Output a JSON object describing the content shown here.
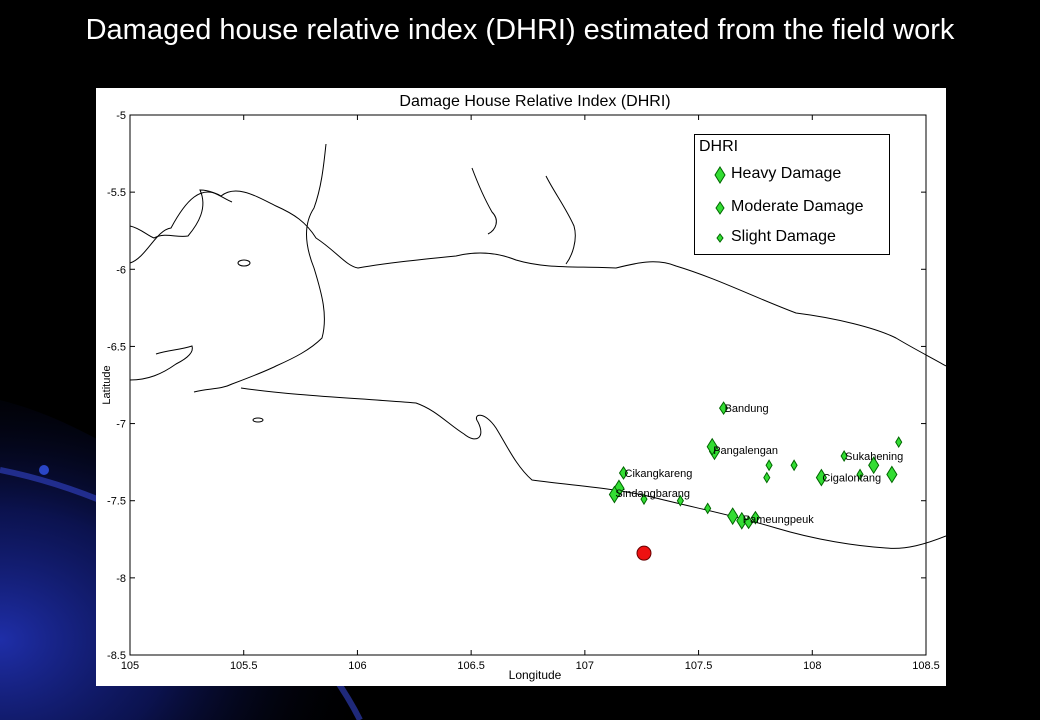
{
  "slide": {
    "title": "Damaged house relative index (DHRI) estimated from the field work"
  },
  "colors": {
    "background": "#000000",
    "swoosh": "#1a2a9a",
    "marker_fill": "#33dd33",
    "marker_stroke": "#006600",
    "epicenter": "#ee1111",
    "coast": "#000000"
  },
  "chart_data": {
    "type": "scatter",
    "title": "Damage House Relative Index (DHRI)",
    "xlabel": "Longitude",
    "ylabel": "Latitude",
    "xlim": [
      105,
      108.5
    ],
    "ylim": [
      -8.5,
      -5
    ],
    "xticks": [
      "105",
      "105.5",
      "106",
      "106.5",
      "107",
      "107.5",
      "108",
      "108.5"
    ],
    "yticks": [
      "-5",
      "-5.5",
      "-6",
      "-6.5",
      "-7",
      "-7.5",
      "-8",
      "-8.5"
    ],
    "grid": false,
    "legend_title": "DHRI",
    "legend_position": "top-right",
    "series": [
      {
        "name": "Heavy Damage",
        "size": "large",
        "points": [
          {
            "x": 107.57,
            "y": -7.18
          },
          {
            "x": 107.56,
            "y": -7.15
          },
          {
            "x": 107.15,
            "y": -7.42
          },
          {
            "x": 107.13,
            "y": -7.46
          },
          {
            "x": 107.65,
            "y": -7.6
          },
          {
            "x": 107.69,
            "y": -7.63
          },
          {
            "x": 108.27,
            "y": -7.27
          },
          {
            "x": 108.04,
            "y": -7.35
          },
          {
            "x": 108.35,
            "y": -7.33
          }
        ]
      },
      {
        "name": "Moderate Damage",
        "size": "medium",
        "points": [
          {
            "x": 107.61,
            "y": -6.9
          },
          {
            "x": 107.17,
            "y": -7.32
          },
          {
            "x": 107.75,
            "y": -7.61
          },
          {
            "x": 107.72,
            "y": -7.64
          }
        ]
      },
      {
        "name": "Slight Damage",
        "size": "small",
        "points": [
          {
            "x": 107.26,
            "y": -7.49
          },
          {
            "x": 107.42,
            "y": -7.5
          },
          {
            "x": 107.54,
            "y": -7.55
          },
          {
            "x": 107.8,
            "y": -7.35
          },
          {
            "x": 107.81,
            "y": -7.27
          },
          {
            "x": 107.92,
            "y": -7.27
          },
          {
            "x": 108.14,
            "y": -7.21
          },
          {
            "x": 108.21,
            "y": -7.33
          },
          {
            "x": 108.38,
            "y": -7.12
          }
        ]
      }
    ],
    "epicenter": {
      "x": 107.26,
      "y": -7.84
    },
    "place_labels": [
      {
        "text": "Bandung",
        "x": 107.61,
        "y": -6.9
      },
      {
        "text": "Pangalengan",
        "x": 107.56,
        "y": -7.17
      },
      {
        "text": "Cikangkareng",
        "x": 107.17,
        "y": -7.32
      },
      {
        "text": "Sindangbarang",
        "x": 107.13,
        "y": -7.45
      },
      {
        "text": "Pameungpeuk",
        "x": 107.69,
        "y": -7.62
      },
      {
        "text": "Sukahening",
        "x": 108.14,
        "y": -7.21
      },
      {
        "text": "Cigalontang",
        "x": 108.04,
        "y": -7.35
      }
    ]
  }
}
